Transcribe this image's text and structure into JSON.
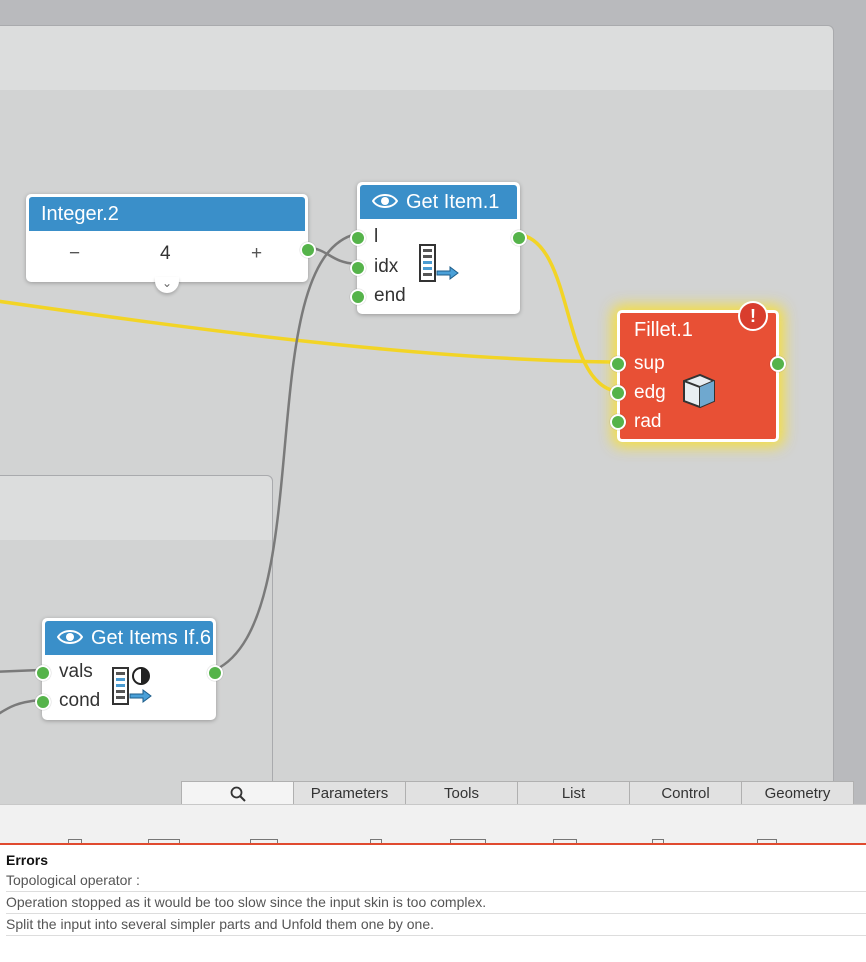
{
  "nodes": {
    "integer": {
      "title": "Integer.2",
      "minus": "−",
      "value": "4",
      "plus": "+",
      "expand": "⌄"
    },
    "get_item": {
      "title": "Get Item.1",
      "inputs": [
        "l",
        "idx",
        "end"
      ]
    },
    "fillet": {
      "title": "Fillet.1",
      "warning": "!",
      "inputs": [
        "sup",
        "edg",
        "rad"
      ]
    },
    "get_items_if": {
      "title": "Get Items If.6",
      "inputs": [
        "vals",
        "cond"
      ]
    }
  },
  "tabs": [
    "Parameters",
    "Tools",
    "List",
    "Control",
    "Geometry"
  ],
  "search_tab_icon": "search-icon",
  "errors": {
    "title": "Errors",
    "lines": [
      "Topological operator :",
      "Operation stopped as it would be too slow since the input skin is too complex.",
      "Split the input into several simpler parts and Unfold them one by one."
    ]
  },
  "colors": {
    "node_header": "#3a8fc9",
    "port": "#55b34a",
    "error_node": "#e85035",
    "highlight_wire": "#f2d426",
    "wire": "#7a7a7a"
  }
}
